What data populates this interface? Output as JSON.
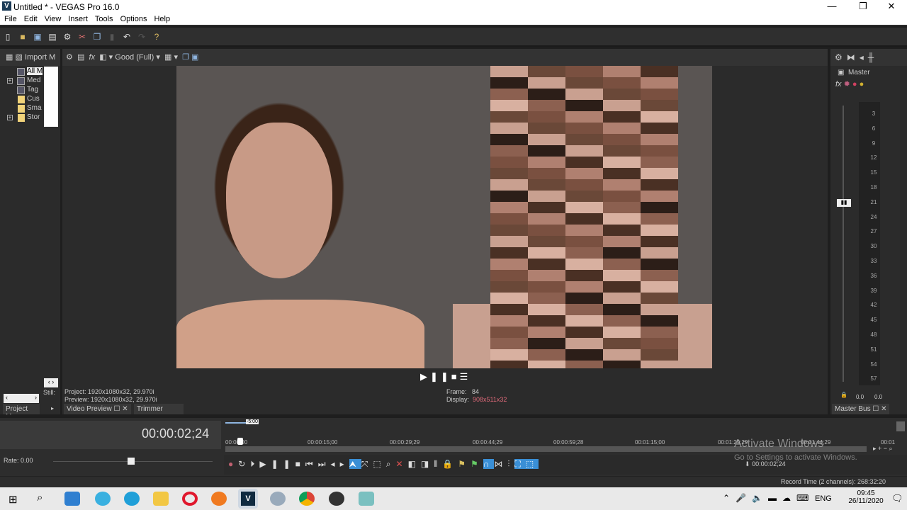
{
  "window": {
    "title": "Untitled * - VEGAS Pro 16.0",
    "app_icon": "V",
    "minimize": "—",
    "maximize": "❐",
    "close": "✕"
  },
  "menu": [
    "File",
    "Edit",
    "View",
    "Insert",
    "Tools",
    "Options",
    "Help"
  ],
  "toolbar_icons": [
    "new-icon",
    "open-icon",
    "save-icon",
    "save-as-icon",
    "properties-icon",
    "cut-icon",
    "copy-icon",
    "paste-icon",
    "undo-icon",
    "redo-icon",
    "help-icon"
  ],
  "explorer": {
    "import_label": "Import M",
    "tree": [
      {
        "label": "All M",
        "type": "pages"
      },
      {
        "label": "Med",
        "type": "pages",
        "expand": true
      },
      {
        "label": "Tag",
        "type": "pages"
      },
      {
        "label": "Cus",
        "type": "folder"
      },
      {
        "label": "Sma",
        "type": "folder"
      },
      {
        "label": "Stor",
        "type": "folder",
        "expand": true
      }
    ],
    "still_label": "Still:",
    "tab": "Project Me"
  },
  "preview": {
    "quality": "Good (Full)",
    "project": "Project:  1920x1080x32, 29.970i",
    "preview": "Preview:  1920x1080x32, 29.970i",
    "frame_label": "Frame:",
    "frame_value": "84",
    "display_label": "Display:",
    "display_value": "908x511x32",
    "tab_video_preview": "Video Preview",
    "tab_trimmer": "Trimmer"
  },
  "mixer": {
    "master": "Master",
    "scale": [
      "3",
      "6",
      "9",
      "12",
      "15",
      "18",
      "21",
      "24",
      "27",
      "30",
      "33",
      "36",
      "39",
      "42",
      "45",
      "48",
      "51",
      "54",
      "57"
    ],
    "left_level": "0.0",
    "right_level": "0.0",
    "tab": "Master Bus"
  },
  "timeline": {
    "time": "00:00:02;24",
    "rate": "Rate: 0.00",
    "region": "-5:00",
    "ticks": [
      "00:00:00",
      "00:00:15;00",
      "00:00:29;29",
      "00:00:44;29",
      "00:00:59;28",
      "00:01:15;00",
      "00:01:29;29",
      "00:01:44;29",
      "00:01"
    ],
    "cursor_time": "00:00:02;24"
  },
  "status": {
    "record_time": "Record Time (2 channels): 268:32:20"
  },
  "watermark": {
    "title": "Activate Windows",
    "sub": "Go to Settings to activate Windows."
  },
  "taskbar": {
    "lang": "ENG",
    "time": "09:45",
    "date": "26/11/2020"
  },
  "colors": {
    "accent": "#3a8fd6",
    "display_value": "#e06a7a"
  }
}
